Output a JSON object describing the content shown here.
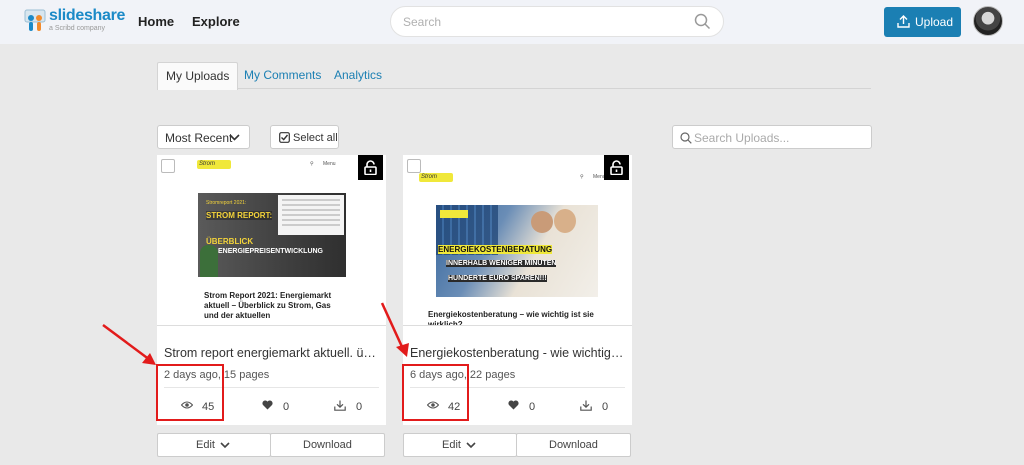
{
  "header": {
    "logo_text": "slideshare",
    "logo_sub": "a Scribd company",
    "nav": [
      "Home",
      "Explore"
    ],
    "search_placeholder": "Search",
    "upload_label": "Upload"
  },
  "tabs": [
    "My Uploads",
    "My Comments",
    "Analytics"
  ],
  "controls": {
    "sort_label": "Most Recent",
    "select_all_label": "Select all",
    "search_uploads_placeholder": "Search Uploads..."
  },
  "cards": [
    {
      "thumb_logo": "Strom",
      "thumb_menu": "Menu",
      "thumb_headline_1": "Stromreport 2021:",
      "thumb_headline_2": "STROM REPORT:",
      "thumb_headline_3": "ÜBERBLICK",
      "thumb_headline_4": "ENERGIEPREISENTWICKLUNG",
      "thumb_caption": "Strom Report 2021: Energiemarkt aktuell – Überblick zu Strom, Gas und der aktuellen",
      "title": "Strom report energiemarkt aktuell. üb...",
      "meta": "2 days ago, 15 pages",
      "views": "45",
      "likes": "0",
      "downloads": "0",
      "edit_label": "Edit",
      "download_label": "Download"
    },
    {
      "thumb_logo": "Strom",
      "thumb_menu": "Menu",
      "thumb_headline_1": "ENERGIEKOSTENBERATUNG",
      "thumb_headline_2": "INNERHALB WENIGER MINUTEN",
      "thumb_headline_3": "HUNDERTE EURO SPAREN!!!",
      "thumb_caption": "Energiekostenberatung – wie wichtig ist sie wirklich?",
      "title": "Energiekostenberatung - wie wichtig i...",
      "meta": "6 days ago, 22 pages",
      "views": "42",
      "likes": "0",
      "downloads": "0",
      "edit_label": "Edit",
      "download_label": "Download"
    }
  ],
  "colors": {
    "brand": "#1b8ac7",
    "upload_button": "#1b7fb3",
    "annotation": "#e21b1b"
  }
}
